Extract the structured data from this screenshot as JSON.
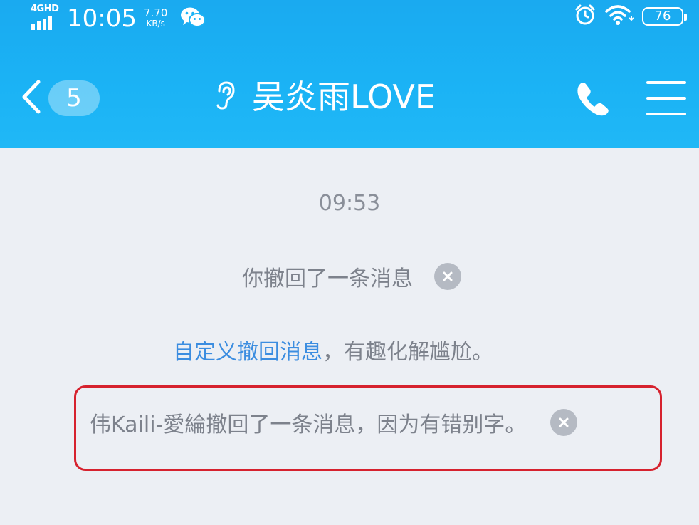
{
  "status_bar": {
    "network": "4GHD",
    "time": "10:05",
    "speed_value": "7.70",
    "speed_unit": "KB/s",
    "battery": "76",
    "icons": [
      "signal-icon",
      "wechat-icon",
      "alarm-icon",
      "wifi-icon",
      "battery-icon"
    ]
  },
  "nav": {
    "unread_count": "5",
    "title": "吴炎雨LOVE",
    "icons": [
      "back-chevron-icon",
      "ear-icon",
      "phone-icon",
      "menu-icon"
    ]
  },
  "chat": {
    "timestamp": "09:53",
    "self_recall_text": "你撤回了一条消息",
    "custom_recall_link": "自定义撤回消息",
    "custom_recall_tip": "，有趣化解尴尬。",
    "other_recall_text": "伟Kaili-愛綸撤回了一条消息，因为有错别字。"
  },
  "colors": {
    "header_blue": "#1bb3f5",
    "background": "#eceff4",
    "link_blue": "#3b8de0",
    "highlight_red": "#d6222e"
  }
}
